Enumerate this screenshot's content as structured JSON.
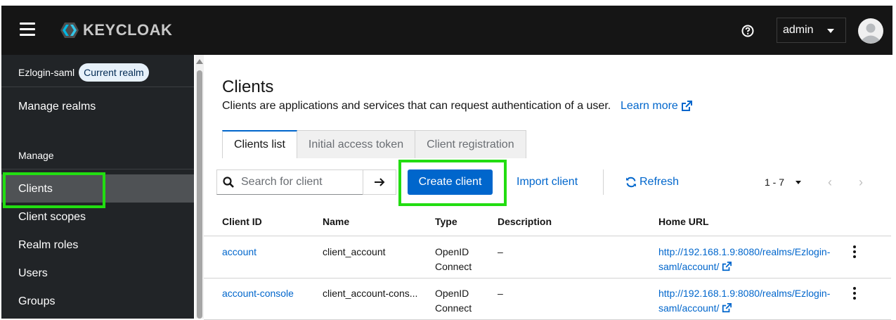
{
  "header": {
    "logo_text": "KEYCLOAK",
    "user_menu_label": "admin"
  },
  "sidebar": {
    "realm_name": "Ezlogin-saml",
    "realm_badge": "Current realm",
    "manage_realms": "Manage realms",
    "section_label": "Manage",
    "items": [
      {
        "label": "Clients",
        "active": true
      },
      {
        "label": "Client scopes"
      },
      {
        "label": "Realm roles"
      },
      {
        "label": "Users"
      },
      {
        "label": "Groups"
      }
    ]
  },
  "page": {
    "title": "Clients",
    "subtitle": "Clients are applications and services that can request authentication of a user.",
    "learn_more": "Learn more",
    "tabs": [
      {
        "label": "Clients list",
        "active": true
      },
      {
        "label": "Initial access token"
      },
      {
        "label": "Client registration"
      }
    ]
  },
  "toolbar": {
    "search_placeholder": "Search for client",
    "create_label": "Create client",
    "import_label": "Import client",
    "refresh_label": "Refresh",
    "pagination": "1 - 7"
  },
  "table": {
    "columns": [
      "Client ID",
      "Name",
      "Type",
      "Description",
      "Home URL"
    ],
    "rows": [
      {
        "client_id": "account",
        "name": "client_account",
        "type_line1": "OpenID",
        "type_line2": "Connect",
        "description": "–",
        "url_line1": "http://192.168.1.9:8080/realms/Ezlogin-",
        "url_line2": "saml/account/"
      },
      {
        "client_id": "account-console",
        "name": "client_account-cons...",
        "type_line1": "OpenID",
        "type_line2": "Connect",
        "description": "–",
        "url_line1": "http://192.168.1.9:8080/realms/Ezlogin-",
        "url_line2": "saml/account/"
      }
    ]
  },
  "colors": {
    "accent": "#0066cc",
    "highlight": "#22dd11",
    "masthead": "#151515",
    "sidebar": "#212427"
  }
}
